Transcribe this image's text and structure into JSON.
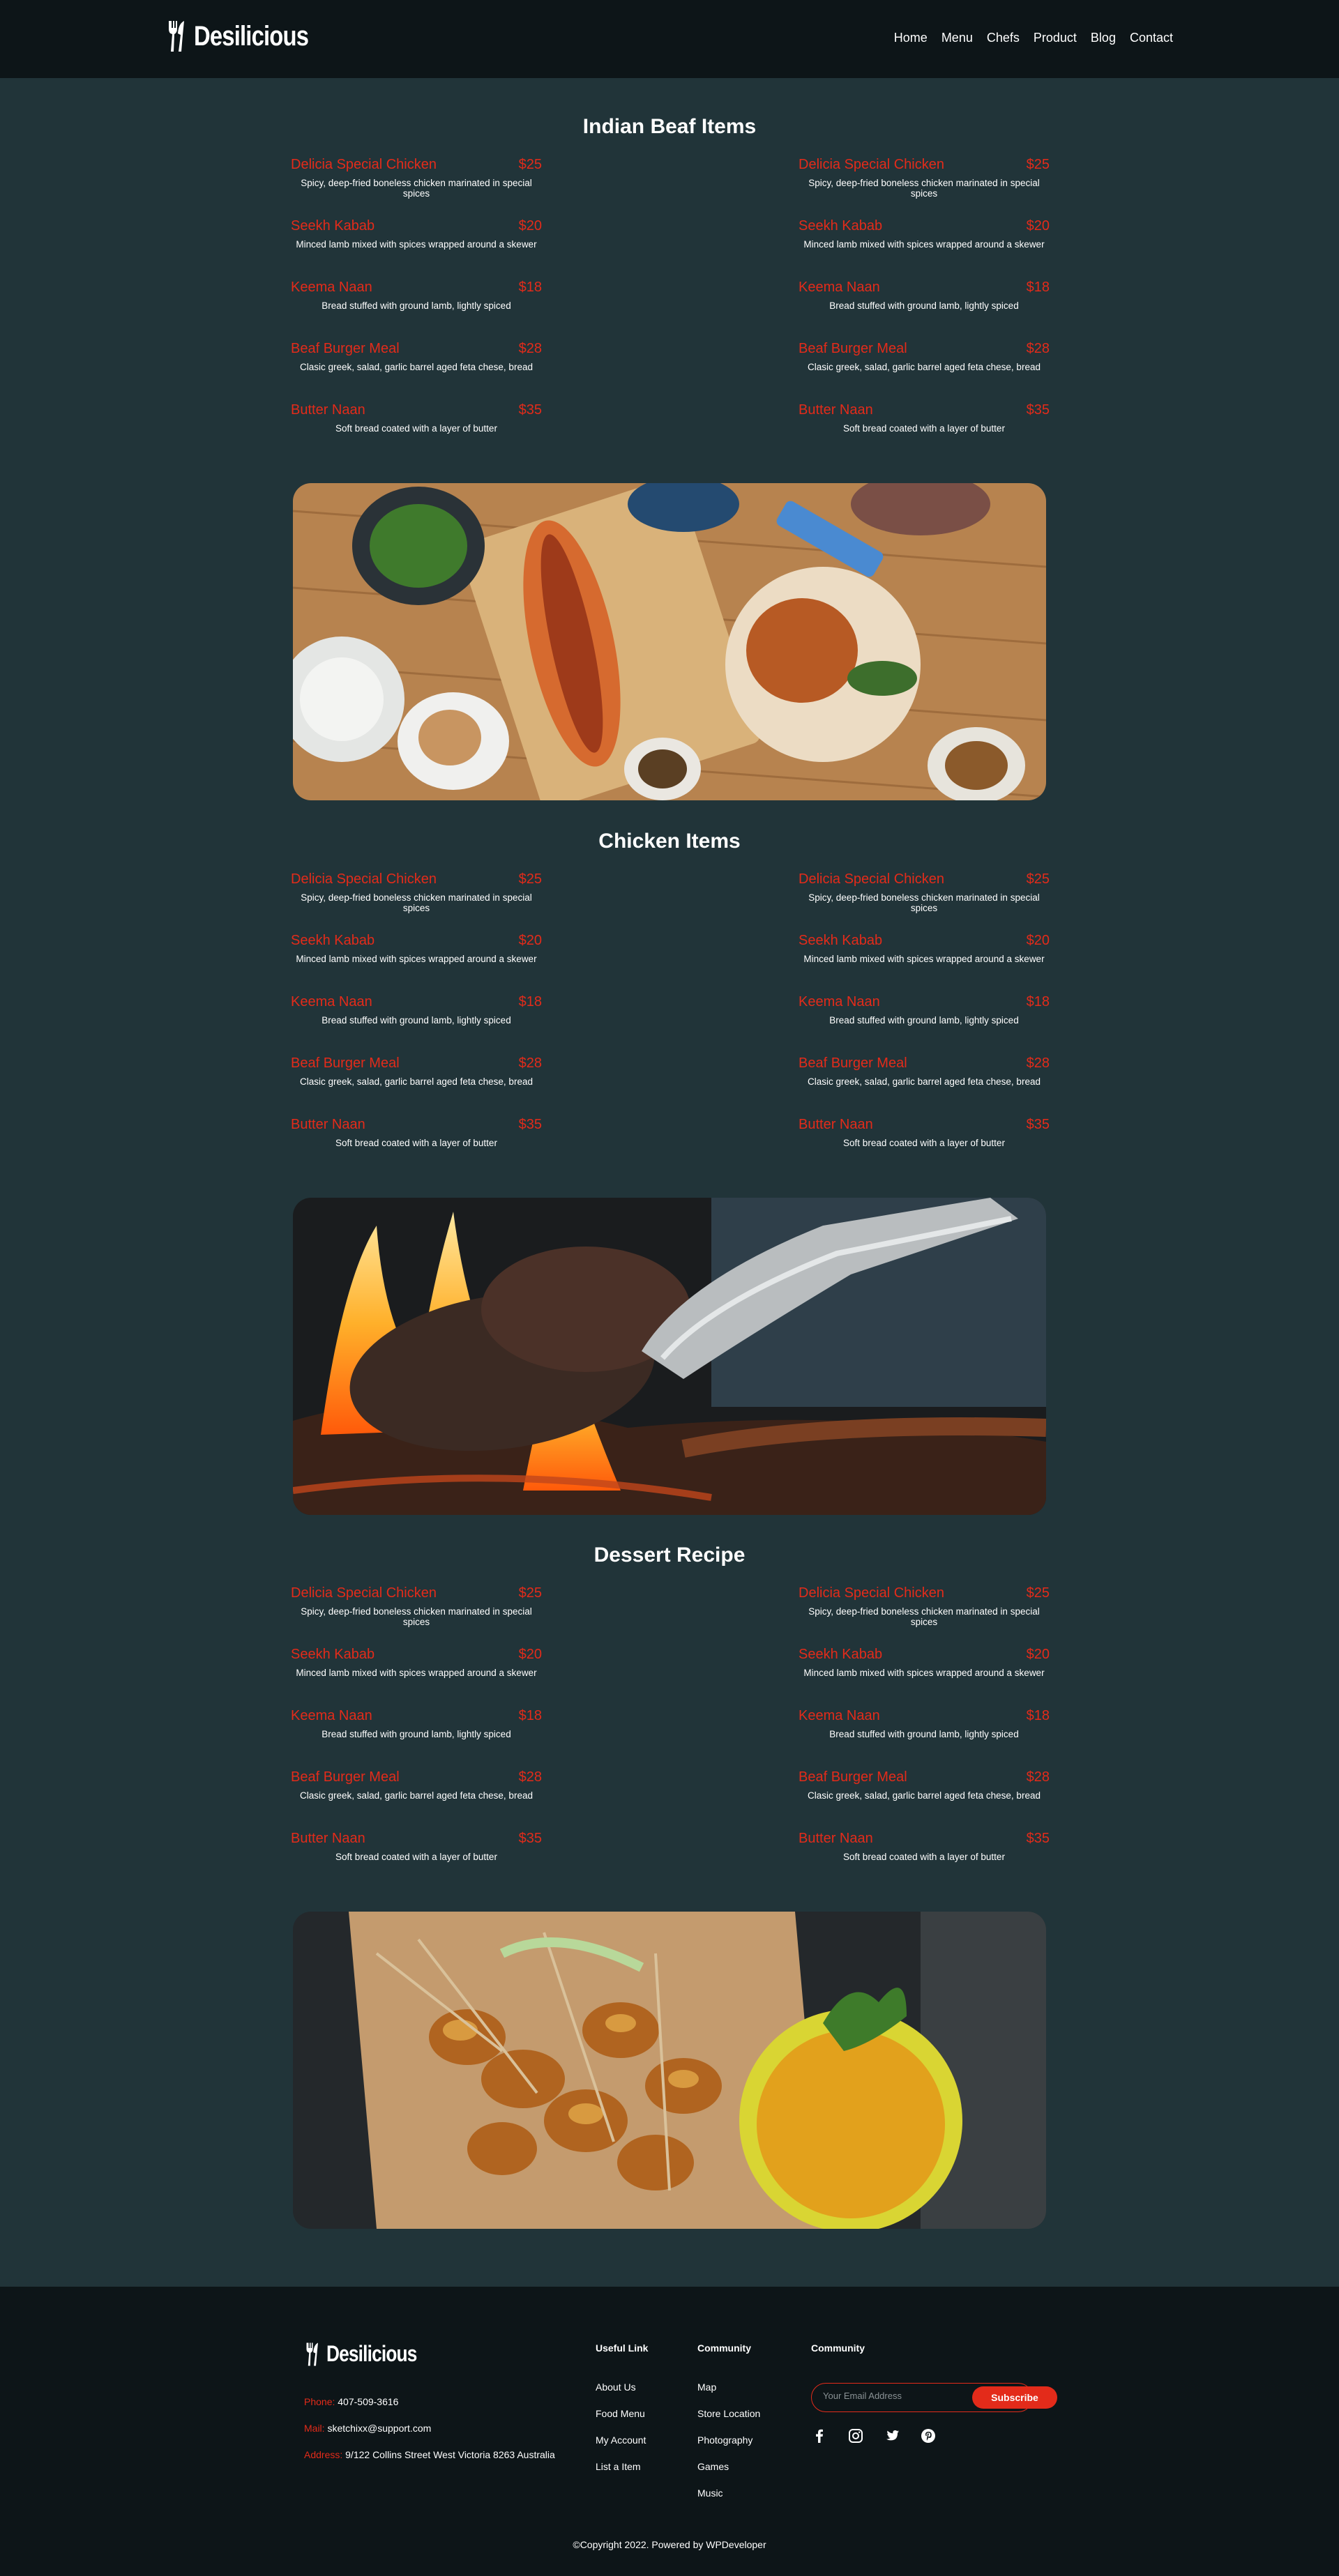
{
  "brand": {
    "name": "Desilicious"
  },
  "nav": [
    "Home",
    "Menu",
    "Chefs",
    "Product",
    "Blog",
    "Contact"
  ],
  "sections": [
    {
      "title": "Indian Beaf Items"
    },
    {
      "title": "Chicken Items"
    },
    {
      "title": "Dessert Recipe"
    }
  ],
  "menu_items": [
    {
      "name": "Delicia Special Chicken",
      "price": "$25",
      "desc": "Spicy, deep-fried boneless chicken marinated in special spices"
    },
    {
      "name": "Seekh Kabab",
      "price": "$20",
      "desc": "Minced lamb mixed with spices wrapped around a skewer"
    },
    {
      "name": "Keema Naan",
      "price": "$18",
      "desc": "Bread stuffed with ground lamb, lightly spiced"
    },
    {
      "name": "Beaf Burger Meal",
      "price": "$28",
      "desc": "Clasic greek, salad, garlic barrel aged feta chese, bread"
    },
    {
      "name": "Butter Naan",
      "price": "$35",
      "desc": "Soft bread coated with a layer of butter"
    }
  ],
  "footer": {
    "phone_label": "Phone:",
    "phone": "407-509-3616",
    "mail_label": "Mail:",
    "mail": "sketchixx@support.com",
    "address_label": "Address:",
    "address": "9/122 Collins Street West Victoria 8263 Australia",
    "useful_title": "Useful Link",
    "useful_links": [
      "About Us",
      "Food Menu",
      "My Account",
      "List a Item"
    ],
    "community_title": "Community",
    "community_links": [
      "Map",
      "Store Location",
      "Photography",
      "Games",
      "Music"
    ],
    "community2_title": "Community",
    "email_placeholder": "Your Email Address",
    "subscribe_label": "Subscribe",
    "socials": [
      "facebook-icon",
      "instagram-icon",
      "twitter-icon",
      "pinterest-icon"
    ],
    "copyright": "©Copyright 2022. Powered by WPDeveloper"
  },
  "colors": {
    "accent": "#e32b1a",
    "body_bg": "#213439",
    "header_bg": "#0d1518"
  }
}
